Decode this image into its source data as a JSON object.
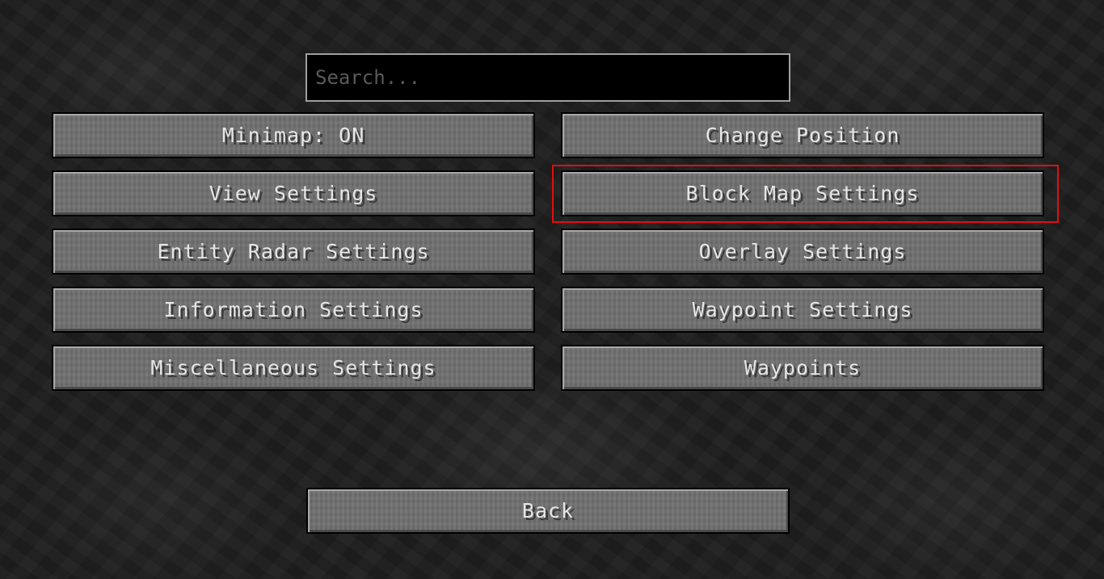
{
  "search": {
    "placeholder": "Search..."
  },
  "buttons": {
    "minimap": "Minimap: ON",
    "change_position": "Change Position",
    "view_settings": "View Settings",
    "block_map_settings": "Block Map Settings",
    "entity_radar_settings": "Entity Radar Settings",
    "overlay_settings": "Overlay Settings",
    "information_settings": "Information Settings",
    "waypoint_settings": "Waypoint Settings",
    "miscellaneous_settings": "Miscellaneous Settings",
    "waypoints": "Waypoints",
    "back": "Back"
  },
  "colors": {
    "button_face": "#6f6f6f",
    "button_text": "#e6e6e6",
    "highlight": "#e01010",
    "search_border": "#a0a0a0"
  }
}
